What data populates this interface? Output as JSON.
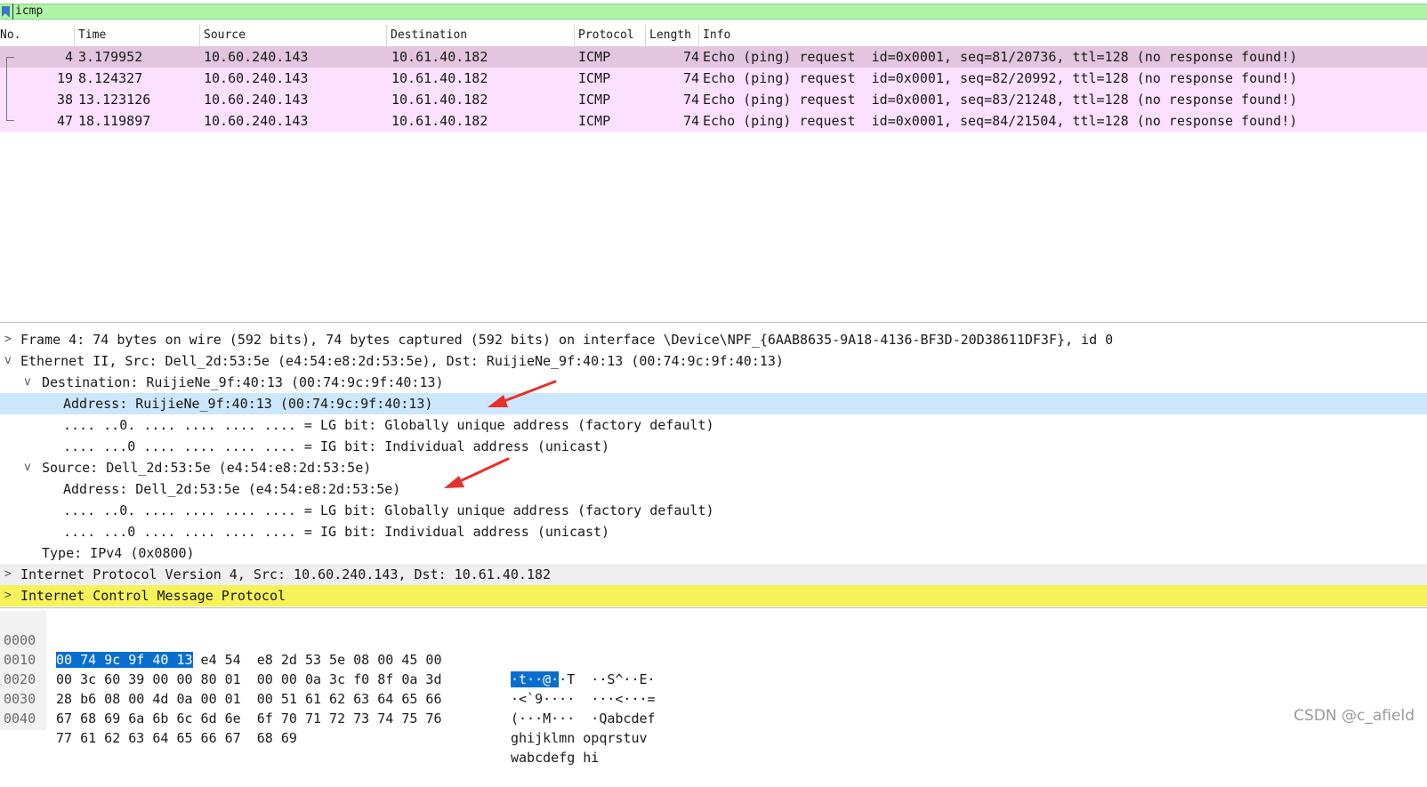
{
  "filter": {
    "value": "icmp"
  },
  "columns": {
    "no": "No.",
    "time": "Time",
    "source": "Source",
    "destination": "Destination",
    "protocol": "Protocol",
    "length": "Length",
    "info": "Info"
  },
  "packets": [
    {
      "no": "4",
      "time": "3.179952",
      "src": "10.60.240.143",
      "dst": "10.61.40.182",
      "proto": "ICMP",
      "len": "74",
      "info": "Echo (ping) request  id=0x0001, seq=81/20736, ttl=128 (no response found!)"
    },
    {
      "no": "19",
      "time": "8.124327",
      "src": "10.60.240.143",
      "dst": "10.61.40.182",
      "proto": "ICMP",
      "len": "74",
      "info": "Echo (ping) request  id=0x0001, seq=82/20992, ttl=128 (no response found!)"
    },
    {
      "no": "38",
      "time": "13.123126",
      "src": "10.60.240.143",
      "dst": "10.61.40.182",
      "proto": "ICMP",
      "len": "74",
      "info": "Echo (ping) request  id=0x0001, seq=83/21248, ttl=128 (no response found!)"
    },
    {
      "no": "47",
      "time": "18.119897",
      "src": "10.60.240.143",
      "dst": "10.61.40.182",
      "proto": "ICMP",
      "len": "74",
      "info": "Echo (ping) request  id=0x0001, seq=84/21504, ttl=128 (no response found!)"
    }
  ],
  "details": {
    "frame": "Frame 4: 74 bytes on wire (592 bits), 74 bytes captured (592 bits) on interface \\Device\\NPF_{6AAB8635-9A18-4136-BF3D-20D38611DF3F}, id 0",
    "ethernet": "Ethernet II, Src: Dell_2d:53:5e (e4:54:e8:2d:53:5e), Dst: RuijieNe_9f:40:13 (00:74:9c:9f:40:13)",
    "dest": "Destination: RuijieNe_9f:40:13 (00:74:9c:9f:40:13)",
    "dest_address": "Address: RuijieNe_9f:40:13 (00:74:9c:9f:40:13)",
    "dest_lg": ".... ..0. .... .... .... .... = LG bit: Globally unique address (factory default)",
    "dest_ig": ".... ...0 .... .... .... .... = IG bit: Individual address (unicast)",
    "src": "Source: Dell_2d:53:5e (e4:54:e8:2d:53:5e)",
    "src_address": "Address: Dell_2d:53:5e (e4:54:e8:2d:53:5e)",
    "src_lg": ".... ..0. .... .... .... .... = LG bit: Globally unique address (factory default)",
    "src_ig": ".... ...0 .... .... .... .... = IG bit: Individual address (unicast)",
    "type": "Type: IPv4 (0x0800)",
    "ip": "Internet Protocol Version 4, Src: 10.60.240.143, Dst: 10.61.40.182",
    "icmp": "Internet Control Message Protocol"
  },
  "twisty": {
    "collapsed": ">",
    "expanded": "v"
  },
  "hex": {
    "offsets": [
      "0000",
      "0010",
      "0020",
      "0030",
      "0040"
    ],
    "sel_bytes": "00 74 9c 9f 40 13",
    "row0_rest": " e4 54  e8 2d 53 5e 08 00 45 00",
    "row1": "00 3c 60 39 00 00 80 01  00 00 0a 3c f0 8f 0a 3d",
    "row2": "28 b6 08 00 4d 0a 00 01  00 51 61 62 63 64 65 66",
    "row3": "67 68 69 6a 6b 6c 6d 6e  6f 70 71 72 73 74 75 76",
    "row4": "77 61 62 63 64 65 66 67  68 69",
    "ascii_sel": "·t··@·",
    "ascii0_rest": "·T  ··S^··E·",
    "ascii1": "·<`9····  ···<···=",
    "ascii2": "(···M···  ·Qabcdef",
    "ascii3": "ghijklmn opqrstuv",
    "ascii4": "wabcdefg hi"
  },
  "watermark": "CSDN @c_afield",
  "colors": {
    "filter_bg": "#aff5a6",
    "row_bg": "#fce0ff",
    "row_selected": "#e2c5df",
    "detail_selected": "#cce6fb",
    "icmp_highlight": "#f5f25a",
    "hex_selected": "#0a6ed1",
    "arrow": "#e8302a"
  }
}
